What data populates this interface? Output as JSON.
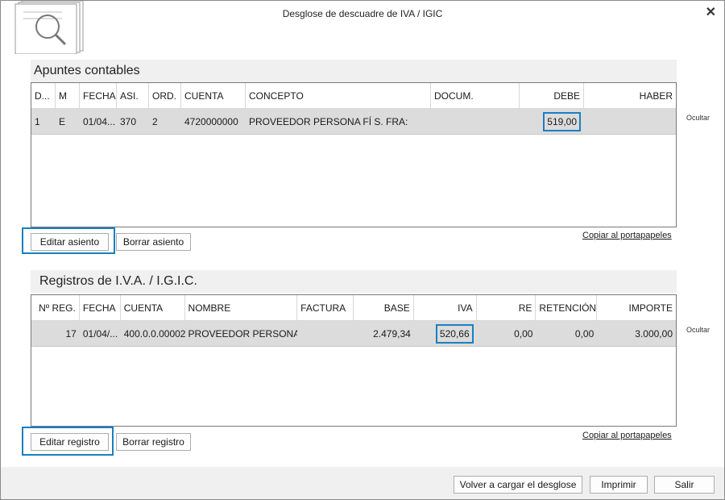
{
  "window": {
    "title": "Desglose de descuadre de IVA / IGIC",
    "close": "✕"
  },
  "apuntes": {
    "header": "Apuntes contables",
    "columns": [
      "D...",
      "M",
      "FECHA",
      "ASI.",
      "ORD.",
      "CUENTA",
      "CONCEPTO",
      "DOCUM.",
      "DEBE",
      "HABER"
    ],
    "rows": [
      {
        "d": "1",
        "m": "E",
        "fecha": "01/04...",
        "asi": "370",
        "ord": "2",
        "cuenta": "4720000000",
        "concepto": "PROVEEDOR PERSONA FÍ S. FRA:",
        "docum": "",
        "debe": "519,00",
        "haber": ""
      }
    ],
    "ocultar": "Ocultar",
    "edit_button": "Editar asiento",
    "delete_button": "Borrar asiento",
    "copy_link": "Copiar al portapapeles"
  },
  "registros": {
    "header": "Registros de I.V.A. / I.G.I.C.",
    "columns": [
      "Nº REG.",
      "FECHA",
      "CUENTA",
      "NOMBRE",
      "FACTURA",
      "BASE",
      "IVA",
      "RE",
      "RETENCIÓN",
      "IMPORTE"
    ],
    "rows": [
      {
        "nreg": "17",
        "fecha": "01/04/...",
        "cuenta": "400.0.0.00002",
        "nombre": "PROVEEDOR PERSONA...",
        "factura": "",
        "base": "2.479,34",
        "iva": "520,66",
        "re": "0,00",
        "retencion": "0,00",
        "importe": "3.000,00"
      }
    ],
    "ocultar": "Ocultar",
    "edit_button": "Editar registro",
    "delete_button": "Borrar registro",
    "copy_link": "Copiar al portapapeles"
  },
  "footer": {
    "reload_button": "Volver a cargar el desglose",
    "print_button": "Imprimir",
    "exit_button": "Salir"
  },
  "colors": {
    "accent": "#1a7fc1",
    "row_bg": "#dcdcdc",
    "header_bg": "#f0f0f0"
  }
}
